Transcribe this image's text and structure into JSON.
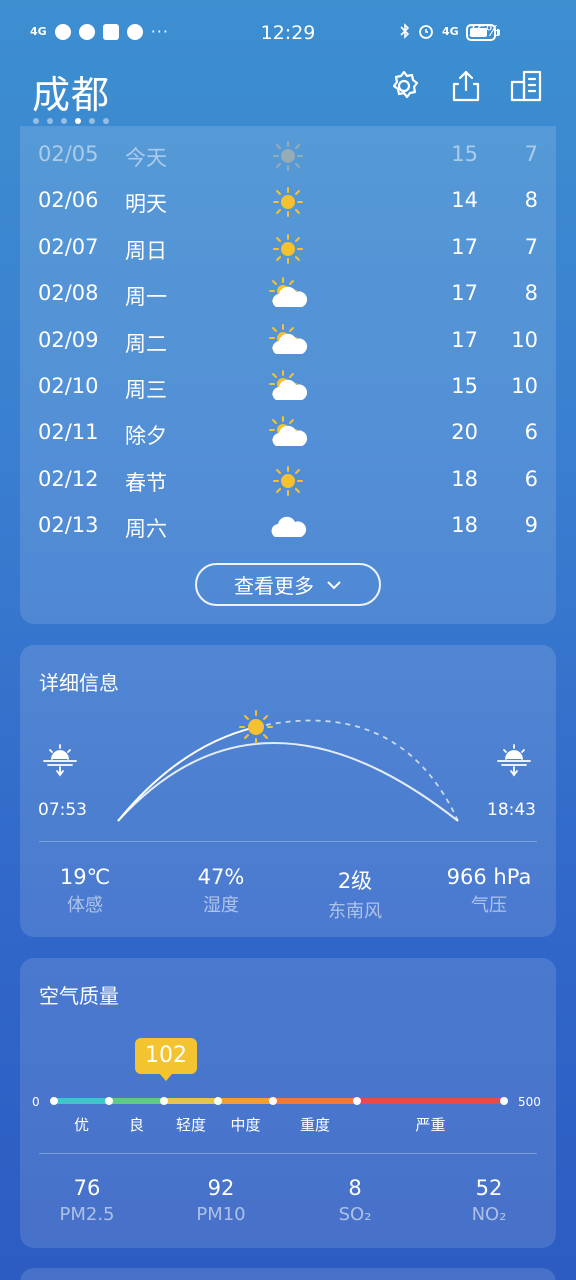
{
  "status_bar": {
    "time": "12:29",
    "network_left": "4G",
    "more": "···",
    "network_right": "4G",
    "battery_text": "76%",
    "battery_level": 0.76
  },
  "header": {
    "city": "成都",
    "page_count": 6,
    "active_page": 4
  },
  "forecast": {
    "rows": [
      {
        "date": "02/05",
        "day": "今天",
        "icon": "sun-icon",
        "high": "15",
        "low": "7"
      },
      {
        "date": "02/06",
        "day": "明天",
        "icon": "sun-icon",
        "high": "14",
        "low": "8"
      },
      {
        "date": "02/07",
        "day": "周日",
        "icon": "sun-icon",
        "high": "17",
        "low": "7"
      },
      {
        "date": "02/08",
        "day": "周一",
        "icon": "partly-cloudy-icon",
        "high": "17",
        "low": "8"
      },
      {
        "date": "02/09",
        "day": "周二",
        "icon": "partly-cloudy-icon",
        "high": "17",
        "low": "10"
      },
      {
        "date": "02/10",
        "day": "周三",
        "icon": "partly-cloudy-icon",
        "high": "15",
        "low": "10"
      },
      {
        "date": "02/11",
        "day": "除夕",
        "icon": "partly-cloudy-icon",
        "high": "20",
        "low": "6"
      },
      {
        "date": "02/12",
        "day": "春节",
        "icon": "sun-icon",
        "high": "18",
        "low": "6"
      },
      {
        "date": "02/13",
        "day": "周六",
        "icon": "cloud-icon",
        "high": "18",
        "low": "9"
      }
    ],
    "more_label": "查看更多"
  },
  "details": {
    "title": "详细信息",
    "sunrise": "07:53",
    "sunset": "18:43",
    "feels_like": {
      "value": "19℃",
      "label": "体感"
    },
    "humidity": {
      "value": "47%",
      "label": "湿度"
    },
    "wind": {
      "value": "2级",
      "label": "东南风"
    },
    "pressure": {
      "value": "966 hPa",
      "label": "气压"
    }
  },
  "air_quality": {
    "title": "空气质量",
    "aqi": "102",
    "scale_min": "0",
    "scale_max": "500",
    "levels": [
      {
        "label": "优",
        "color": "#3cc8c8"
      },
      {
        "label": "良",
        "color": "#5ec98a"
      },
      {
        "label": "轻度",
        "color": "#e8c24a"
      },
      {
        "label": "中度",
        "color": "#f0a030"
      },
      {
        "label": "重度",
        "color": "#ef7a3a"
      },
      {
        "label": "严重",
        "color": "#e84a4a"
      }
    ],
    "pollutants": [
      {
        "value": "76",
        "label": "PM2.5"
      },
      {
        "value": "92",
        "label": "PM10"
      },
      {
        "value": "8",
        "label": "SO₂"
      },
      {
        "value": "52",
        "label": "NO₂"
      }
    ]
  }
}
